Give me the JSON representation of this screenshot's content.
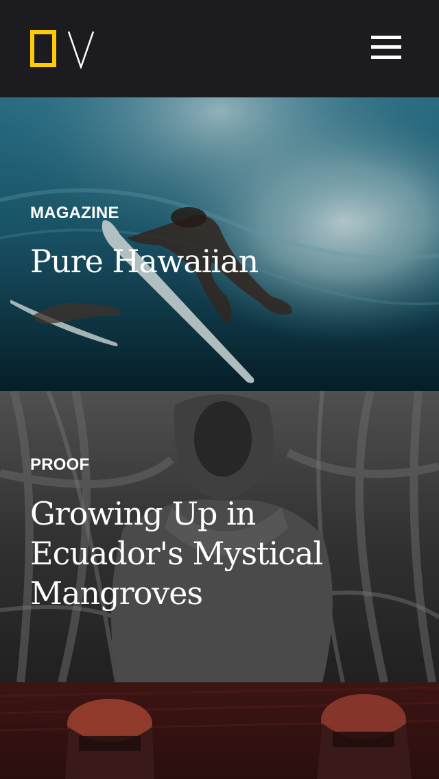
{
  "header": {
    "logo_icon": "national-geographic-yellow-border-icon",
    "menu_icon": "hamburger-menu-icon",
    "logo_color": "#ffcc00"
  },
  "cards": [
    {
      "tag": "MAGAZINE",
      "title": "Pure Hawaiian"
    },
    {
      "tag": "PROOF",
      "title": "Growing Up in Ecuador's Mystical Mangroves"
    }
  ],
  "colors": {
    "header_background": "#1b1b20",
    "text": "#ffffff"
  }
}
